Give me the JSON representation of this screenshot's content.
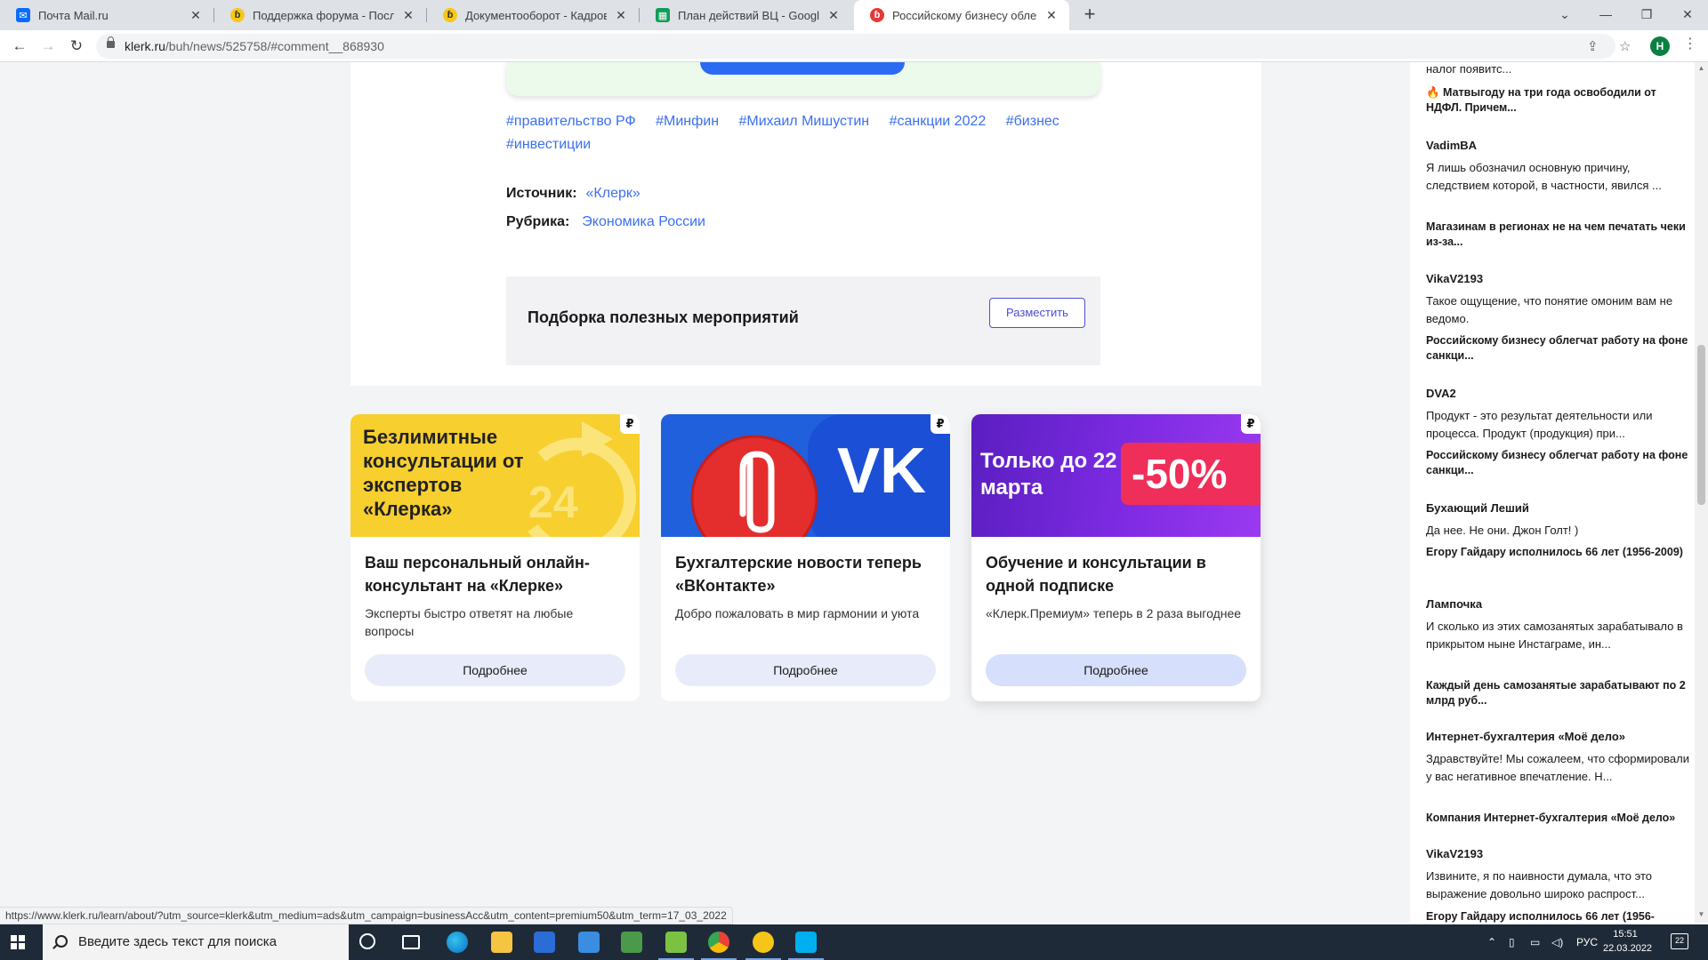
{
  "browser": {
    "tabs": [
      {
        "title": "Почта Mail.ru",
        "active": false
      },
      {
        "title": "Поддержка форума - Последни",
        "active": false
      },
      {
        "title": "Документооборот - Кадровый у",
        "active": false
      },
      {
        "title": "План действий ВЦ - Google Таб",
        "active": false
      },
      {
        "title": "Российскому бизнесу облегчат",
        "active": true
      }
    ],
    "url_host": "klerk.ru",
    "url_path": "/buh/news/525758/#comment__868930",
    "profile_letter": "H"
  },
  "article": {
    "tags": [
      "#правительство РФ",
      "#Минфин",
      "#Михаил Мишустин",
      "#санкции 2022",
      "#бизнес",
      "#инвестиции"
    ],
    "source_label": "Источник:",
    "source_value": "«Клерк»",
    "rubric_label": "Рубрика:",
    "rubric_value": "Экономика России",
    "events_title": "Подборка полезных мероприятий",
    "events_button": "Разместить"
  },
  "promos": [
    {
      "banner_text": "Безлимитные консультации от экспертов «Клерка»",
      "banner_badge": "24",
      "title": "Ваш персональный онлайн-консультант на «Клерке»",
      "desc": "Эксперты быстро ответят на любые вопросы",
      "button": "Подробнее",
      "currency": "₽"
    },
    {
      "banner_text": "",
      "title": "Бухгалтерские новости теперь «ВКонтакте»",
      "desc": "Добро пожаловать в мир гармонии и уюта",
      "button": "Подробнее",
      "currency": "₽"
    },
    {
      "banner_text": "Только до 22 марта",
      "banner_sale": "-50%",
      "title": "Обучение и консультации в одной подписке",
      "desc": "«Клерк.Премиум» теперь в 2 раза выгоднее",
      "button": "Подробнее",
      "currency": "₽"
    }
  ],
  "comments": {
    "top_fragment": "налог появитс...",
    "top_link": "🔥 Матвыгоду на три года освободили от НДФЛ. Причем...",
    "items": [
      {
        "author": "VadimBA",
        "text": "Я лишь обозначил основную причину, следствием которой, в частности, явился ...",
        "link": "Магазинам в регионах не на чем печатать чеки из-за..."
      },
      {
        "author": "VikaV2193",
        "text": "Такое ощущение, что понятие омоним вам не ведомо.",
        "link": "Российскому бизнесу облегчат работу на фоне санкци..."
      },
      {
        "author": "DVA2",
        "text": "Продукт - это результат деятельности или процесса. Продукт (продукция) при...",
        "link": "Российскому бизнесу облегчат работу на фоне санкци..."
      },
      {
        "author": "Бухающий Леший",
        "text": "Да нее. Не они. Джон Голт! )",
        "link": "Егору Гайдару исполнилось 66 лет (1956-2009)"
      },
      {
        "author": "Лампочка",
        "text": "И сколько из этих самозанятых зарабатывало в прикрытом ныне Инстаграме, ин...",
        "link": "Каждый день самозанятые зарабатывают по 2 млрд руб..."
      },
      {
        "author": "Интернет-бухгалтерия «Моё дело»",
        "text": "Здравствуйте! Мы сожалеем, что сформировали у вас негативное впечатление. Н...",
        "link": "Компания Интернет-бухгалтерия «Моё дело»"
      },
      {
        "author": "VikaV2193",
        "text": "Извините, я по наивности думала, что это выражение довольно широко распрост...",
        "link": "Егору Гайдару исполнилось 66 лет (1956-"
      }
    ]
  },
  "status_url": "https://www.klerk.ru/learn/about/?utm_source=klerk&utm_medium=ads&utm_campaign=businessAcc&utm_content=premium50&utm_term=17_03_2022",
  "taskbar": {
    "search_placeholder": "Введите здесь текст для поиска",
    "language": "РУС",
    "time": "15:51",
    "date": "22.03.2022",
    "notifications": "22"
  }
}
